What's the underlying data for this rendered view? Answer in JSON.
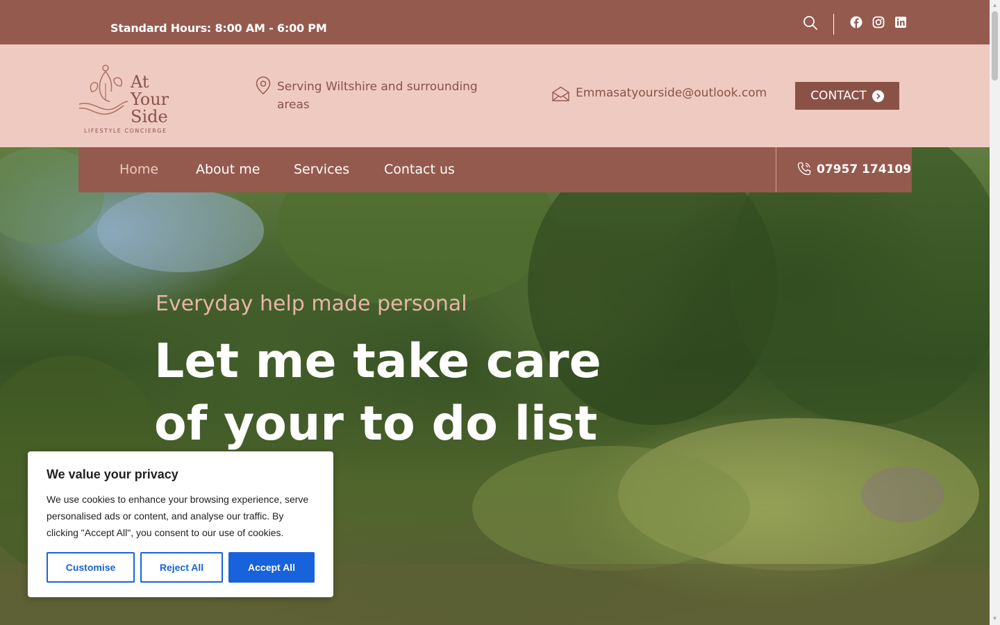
{
  "topbar": {
    "hours": "Standard Hours: 8:00 AM - 6:00 PM",
    "icons": [
      "search-icon",
      "facebook-icon",
      "instagram-icon",
      "linkedin-icon"
    ]
  },
  "header": {
    "logo": {
      "line1": "At",
      "line2": "Your",
      "line3": "Side",
      "tagline": "LIFESTYLE CONCIERGE"
    },
    "location": "Serving Wiltshire and surrounding areas",
    "email": "Emmasatyourside@outlook.com",
    "contact_button": "CONTACT"
  },
  "nav": {
    "items": [
      {
        "label": "Home",
        "active": true
      },
      {
        "label": "About me"
      },
      {
        "label": "Services"
      },
      {
        "label": "Contact us"
      }
    ],
    "phone": "07957 174109"
  },
  "hero": {
    "tagline": "Everyday help made personal",
    "headline": "Let me take care of your to do list"
  },
  "cookie": {
    "title": "We value your privacy",
    "text": "We use cookies to enhance your browsing experience, serve personalised ads or content, and analyse our traffic. By clicking \"Accept All\", you consent to our use of cookies.",
    "customise": "Customise",
    "reject": "Reject All",
    "accept": "Accept All"
  },
  "colors": {
    "brand_dark": "#955a4e",
    "brand_light": "#efcac1",
    "cookie_accent": "#1863dc"
  }
}
